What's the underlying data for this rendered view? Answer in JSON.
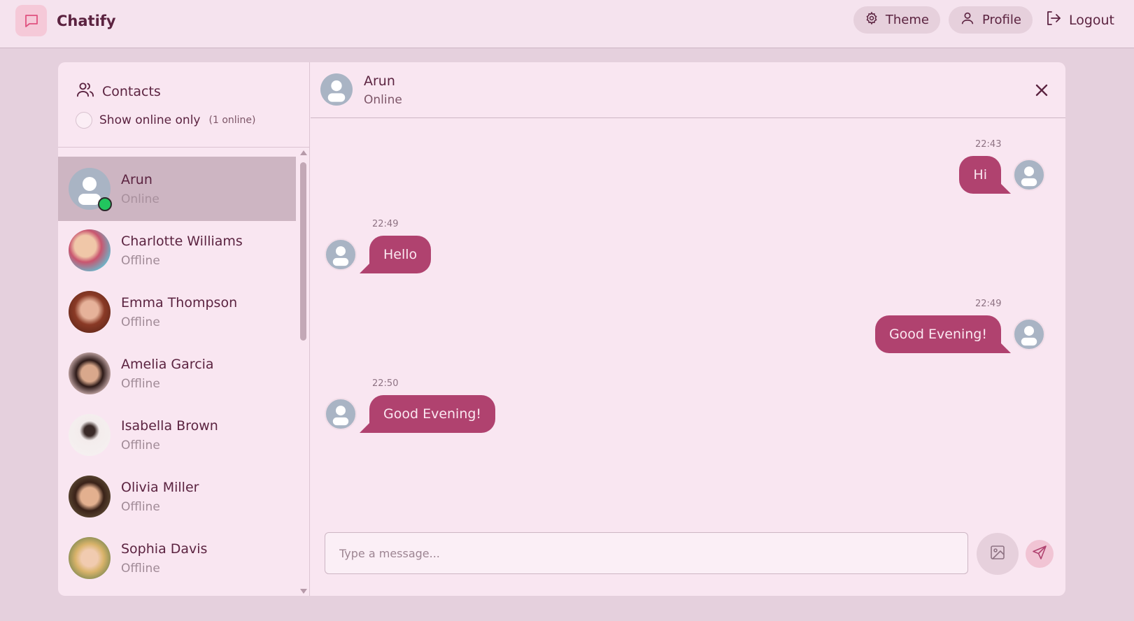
{
  "app": {
    "name": "Chatify"
  },
  "nav": {
    "theme_label": "Theme",
    "profile_label": "Profile",
    "logout_label": "Logout"
  },
  "sidebar": {
    "title": "Contacts",
    "filter_label": "Show online only",
    "online_count": "(1 online)",
    "contacts": [
      {
        "name": "Arun",
        "status": "Online",
        "avatar": "default-user-icon",
        "active": true
      },
      {
        "name": "Charlotte Williams",
        "status": "Offline",
        "avatar": "photo"
      },
      {
        "name": "Emma Thompson",
        "status": "Offline",
        "avatar": "photo"
      },
      {
        "name": "Amelia Garcia",
        "status": "Offline",
        "avatar": "photo"
      },
      {
        "name": "Isabella Brown",
        "status": "Offline",
        "avatar": "photo"
      },
      {
        "name": "Olivia Miller",
        "status": "Offline",
        "avatar": "photo"
      },
      {
        "name": "Sophia Davis",
        "status": "Offline",
        "avatar": "photo"
      }
    ]
  },
  "chat": {
    "contact_name": "Arun",
    "contact_status": "Online",
    "messages": [
      {
        "direction": "out",
        "time": "22:43",
        "text": "Hi"
      },
      {
        "direction": "in",
        "time": "22:49",
        "text": "Hello"
      },
      {
        "direction": "out",
        "time": "22:49",
        "text": "Good Evening!"
      },
      {
        "direction": "in",
        "time": "22:50",
        "text": "Good Evening!"
      }
    ],
    "input_placeholder": "Type a message..."
  },
  "colors": {
    "accent": "#b0426f",
    "background": "#e5d0dd",
    "panel": "#f9e6f1",
    "online": "#22c55e"
  }
}
